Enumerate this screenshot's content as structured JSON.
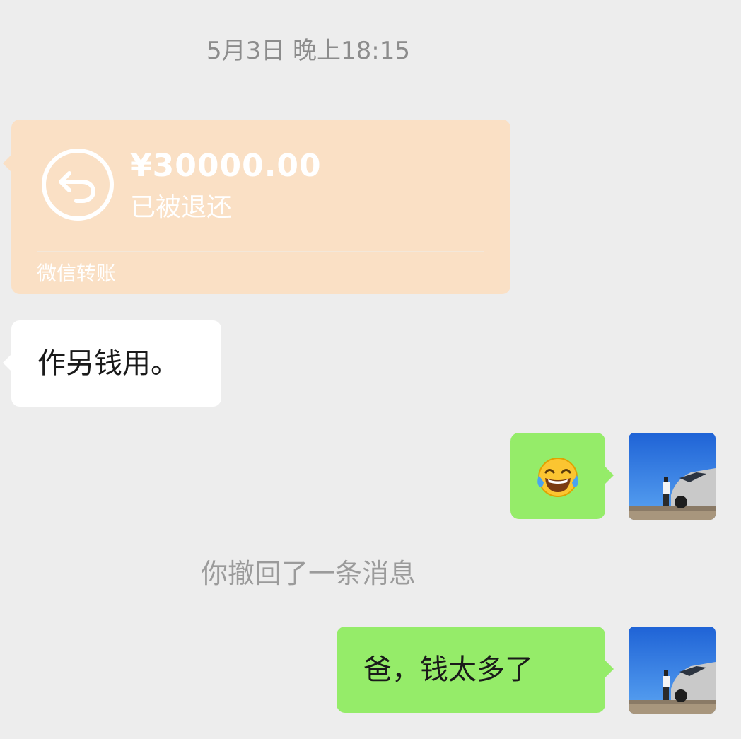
{
  "chat": {
    "timestamp": "5月3日 晚上18:15",
    "transfer": {
      "amount": "¥30000.00",
      "status": "已被退还",
      "footer": "微信转账",
      "icon": "return-arrow-icon",
      "card_color": "#fae0c5"
    },
    "messages": [
      {
        "from": "other",
        "type": "text",
        "text": "作另钱用。"
      },
      {
        "from": "me",
        "type": "emoji",
        "emoji": "😂",
        "icon": "tears-of-joy-emoji"
      },
      {
        "from": "me",
        "type": "text",
        "text": "爸，钱太多了"
      }
    ],
    "system_note": "你撤回了一条消息",
    "colors": {
      "background": "#ededed",
      "outgoing_bubble": "#95ec69",
      "incoming_bubble": "#ffffff"
    }
  }
}
